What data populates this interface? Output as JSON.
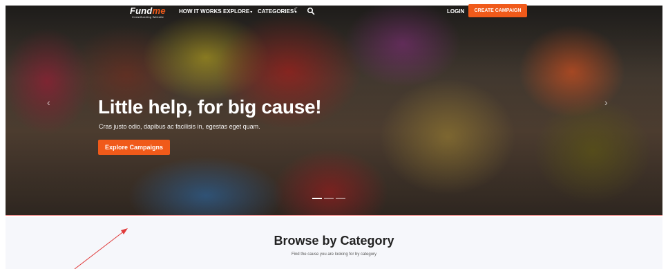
{
  "nav": {
    "logo_main": "Fund",
    "logo_accent": "me",
    "logo_tagline": "Crowdfunding Website",
    "links": [
      "HOW IT WORKS",
      "EXPLORE",
      "CATEGORIES"
    ],
    "login": "LOGIN",
    "cta": "CREATE CAMPAIGN",
    "caret_icon": "chevron-down-icon",
    "theme_icon": "moon-icon",
    "search_icon": "search-icon"
  },
  "hero": {
    "headline": "Little help, for big cause!",
    "subtext": "Cras justo odio, dapibus ac facilisis in, egestas eget quam.",
    "button": "Explore Campaigns",
    "slide_count": 3,
    "active_slide": 1,
    "prev_icon": "chevron-left-icon",
    "next_icon": "chevron-right-icon"
  },
  "section": {
    "title": "Browse by Category",
    "subtitle": "Find the cause you are looking for by category"
  },
  "colors": {
    "accent": "#f05a1a",
    "annotation": "#e03a3a",
    "section_bg": "#f6f7fb"
  }
}
